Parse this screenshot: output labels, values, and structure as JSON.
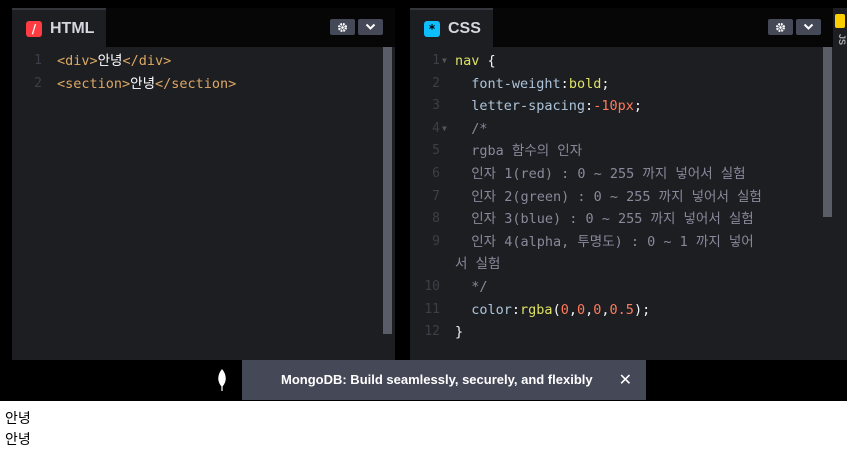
{
  "html_panel": {
    "title": "HTML",
    "icon": "codepen-html-icon",
    "accent": "#ff3c41",
    "lines": [
      {
        "n": "1",
        "parts": [
          [
            "t-tag",
            "<div>"
          ],
          [
            "t-text",
            "안녕"
          ],
          [
            "t-tag",
            "</div>"
          ]
        ]
      },
      {
        "n": "2",
        "parts": [
          [
            "t-tag",
            "<section>"
          ],
          [
            "t-text",
            "안녕"
          ],
          [
            "t-tag",
            "</section>"
          ]
        ]
      }
    ]
  },
  "css_panel": {
    "title": "CSS",
    "icon": "codepen-css-icon",
    "accent": "#0ebeff",
    "lines": [
      {
        "n": "1",
        "fold": true,
        "parts": [
          [
            "t-sel",
            "nav "
          ],
          [
            "t-punc",
            "{"
          ]
        ]
      },
      {
        "n": "2",
        "parts": [
          [
            "t-prop",
            "  font-weight"
          ],
          [
            "t-punc",
            ":"
          ],
          [
            "t-val",
            "bold"
          ],
          [
            "t-punc",
            ";"
          ]
        ]
      },
      {
        "n": "3",
        "parts": [
          [
            "t-prop",
            "  letter-spacing"
          ],
          [
            "t-punc",
            ":"
          ],
          [
            "t-num",
            "-10px"
          ],
          [
            "t-punc",
            ";"
          ]
        ]
      },
      {
        "n": "4",
        "fold": true,
        "parts": [
          [
            "t-comment",
            "  /*"
          ]
        ]
      },
      {
        "n": "5",
        "parts": [
          [
            "t-comment",
            "  rgba 함수의 인자"
          ]
        ]
      },
      {
        "n": "6",
        "parts": [
          [
            "t-comment",
            "  인자 1(red) : 0 ~ 255 까지 넣어서 실험"
          ]
        ]
      },
      {
        "n": "7",
        "parts": [
          [
            "t-comment",
            "  인자 2(green) : 0 ~ 255 까지 넣어서 실험"
          ]
        ]
      },
      {
        "n": "8",
        "parts": [
          [
            "t-comment",
            "  인자 3(blue) : 0 ~ 255 까지 넣어서 실험"
          ]
        ]
      },
      {
        "n": "9",
        "parts": [
          [
            "t-comment",
            "  인자 4(alpha, 투명도) : 0 ~ 1 까지 넣어"
          ]
        ]
      },
      {
        "n": "",
        "parts": [
          [
            "t-comment",
            "서 실험"
          ]
        ]
      },
      {
        "n": "10",
        "parts": [
          [
            "t-comment",
            "  */"
          ]
        ]
      },
      {
        "n": "11",
        "parts": [
          [
            "t-prop",
            "  color"
          ],
          [
            "t-punc",
            ":"
          ],
          [
            "t-val",
            "rgba"
          ],
          [
            "t-punc",
            "("
          ],
          [
            "t-num",
            "0"
          ],
          [
            "t-punc",
            ","
          ],
          [
            "t-num",
            "0"
          ],
          [
            "t-punc",
            ","
          ],
          [
            "t-num",
            "0"
          ],
          [
            "t-punc",
            ","
          ],
          [
            "t-num",
            "0.5"
          ],
          [
            "t-punc",
            ");"
          ]
        ]
      },
      {
        "n": "12",
        "parts": [
          [
            "t-punc",
            "}"
          ]
        ]
      }
    ]
  },
  "js_panel": {
    "label": "JS",
    "accent": "#fcd000"
  },
  "promo": {
    "icon": "mongodb-leaf-icon",
    "text": "MongoDB: Build seamlessly, securely, and flexibly",
    "close": "✕"
  },
  "preview": {
    "lines": [
      "안녕",
      "안녕"
    ]
  }
}
